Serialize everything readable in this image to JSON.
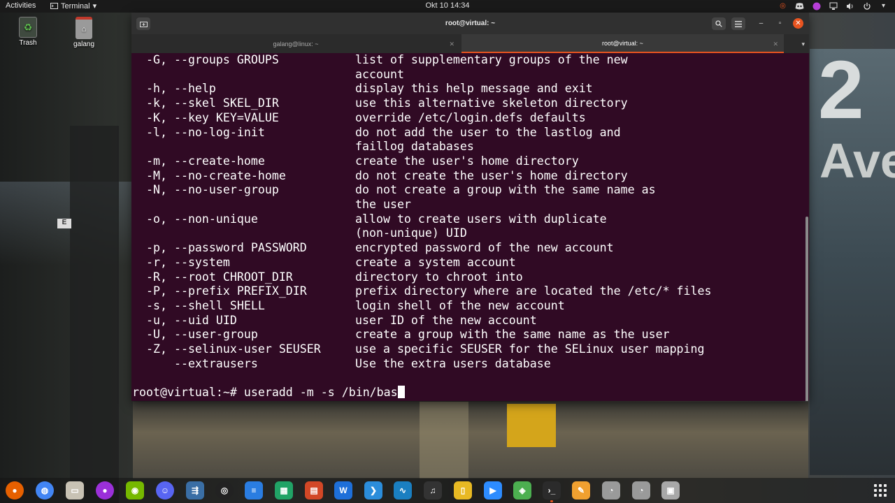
{
  "topbar": {
    "activities": "Activities",
    "app_menu": "Terminal",
    "clock": "Okt 10  14:34"
  },
  "desktop": {
    "icons": [
      {
        "label": "Trash"
      },
      {
        "label": "galang"
      }
    ]
  },
  "wallpaper": {
    "sign_number": "2",
    "sign_text": "Ave",
    "letter": "E"
  },
  "window": {
    "title": "root@virtual: ~",
    "tabs": [
      {
        "label": "galang@linux: ~"
      },
      {
        "label": "root@virtual: ~"
      }
    ]
  },
  "terminal": {
    "lines": [
      {
        "opt": "-G, --groups GROUPS",
        "desc": "list of supplementary groups of the new"
      },
      {
        "opt": "",
        "desc": "account"
      },
      {
        "opt": "-h, --help",
        "desc": "display this help message and exit"
      },
      {
        "opt": "-k, --skel SKEL_DIR",
        "desc": "use this alternative skeleton directory"
      },
      {
        "opt": "-K, --key KEY=VALUE",
        "desc": "override /etc/login.defs defaults"
      },
      {
        "opt": "-l, --no-log-init",
        "desc": "do not add the user to the lastlog and"
      },
      {
        "opt": "",
        "desc": "faillog databases"
      },
      {
        "opt": "-m, --create-home",
        "desc": "create the user's home directory"
      },
      {
        "opt": "-M, --no-create-home",
        "desc": "do not create the user's home directory"
      },
      {
        "opt": "-N, --no-user-group",
        "desc": "do not create a group with the same name as"
      },
      {
        "opt": "",
        "desc": "the user"
      },
      {
        "opt": "-o, --non-unique",
        "desc": "allow to create users with duplicate"
      },
      {
        "opt": "",
        "desc": "(non-unique) UID"
      },
      {
        "opt": "-p, --password PASSWORD",
        "desc": "encrypted password of the new account"
      },
      {
        "opt": "-r, --system",
        "desc": "create a system account"
      },
      {
        "opt": "-R, --root CHROOT_DIR",
        "desc": "directory to chroot into"
      },
      {
        "opt": "-P, --prefix PREFIX_DIR",
        "desc": "prefix directory where are located the /etc/* files"
      },
      {
        "opt": "-s, --shell SHELL",
        "desc": "login shell of the new account"
      },
      {
        "opt": "-u, --uid UID",
        "desc": "user ID of the new account"
      },
      {
        "opt": "-U, --user-group",
        "desc": "create a group with the same name as the user"
      },
      {
        "opt": "-Z, --selinux-user SEUSER",
        "desc": "use a specific SEUSER for the SELinux user mapping"
      },
      {
        "opt": "    --extrausers",
        "desc": "Use the extra users database"
      }
    ],
    "prompt": "root@virtual:~# ",
    "command": "useradd -m -s /bin/bas"
  },
  "dock": {
    "items": [
      {
        "name": "firefox-icon",
        "color": "#e66000"
      },
      {
        "name": "chrome-icon",
        "color": "#4285f4"
      },
      {
        "name": "files-icon",
        "color": "#c8c2b4"
      },
      {
        "name": "firefox-dev-icon",
        "color": "#9b30d9"
      },
      {
        "name": "nvidia-icon",
        "color": "#76b900"
      },
      {
        "name": "discord-icon",
        "color": "#5865f2"
      },
      {
        "name": "flow-icon",
        "color": "#3a6ea5"
      },
      {
        "name": "obs-icon",
        "color": "#222222"
      },
      {
        "name": "docs-icon",
        "color": "#2a7de1"
      },
      {
        "name": "sheets-icon",
        "color": "#21a366"
      },
      {
        "name": "slides-icon",
        "color": "#d24726"
      },
      {
        "name": "word-icon",
        "color": "#1e6fd9"
      },
      {
        "name": "vscode-icon",
        "color": "#2b8ddb"
      },
      {
        "name": "monitor-icon",
        "color": "#1a7fc1"
      },
      {
        "name": "music-icon",
        "color": "#333333"
      },
      {
        "name": "notes-icon",
        "color": "#e8b923"
      },
      {
        "name": "zoom-icon",
        "color": "#2d8cff"
      },
      {
        "name": "android-icon",
        "color": "#4caf50"
      },
      {
        "name": "terminal-icon",
        "color": "#2b2b2b"
      },
      {
        "name": "editor-icon",
        "color": "#f0a030"
      },
      {
        "name": "disk-icon",
        "color": "#9a9a9a"
      },
      {
        "name": "disk2-icon",
        "color": "#9a9a9a"
      },
      {
        "name": "ssd-icon",
        "color": "#a8a8a8"
      }
    ]
  },
  "colors": {
    "terminal_bg": "#300a24",
    "accent": "#e95420"
  }
}
